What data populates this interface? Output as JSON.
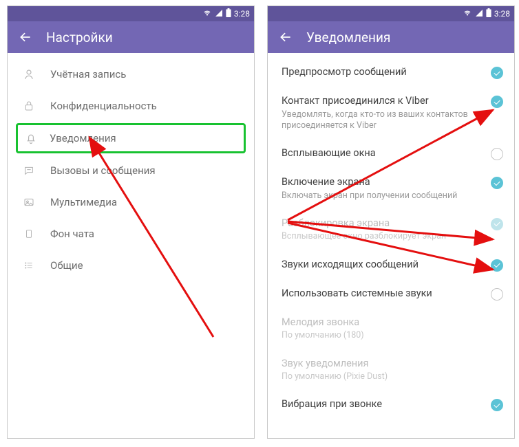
{
  "status": {
    "time": "3:28"
  },
  "left": {
    "title": "Настройки",
    "items": [
      {
        "label": "Учётная запись",
        "icon": "user"
      },
      {
        "label": "Конфиденциальность",
        "icon": "lock"
      },
      {
        "label": "Уведомления",
        "icon": "bell",
        "highlight": true
      },
      {
        "label": "Вызовы и сообщения",
        "icon": "chat"
      },
      {
        "label": "Мультимедиа",
        "icon": "media"
      },
      {
        "label": "Фон чата",
        "icon": "phone"
      },
      {
        "label": "Общие",
        "icon": "list"
      }
    ]
  },
  "right": {
    "title": "Уведомления",
    "items": [
      {
        "title": "Предпросмотр сообщений",
        "sub": "",
        "state": "on"
      },
      {
        "title": "Контакт присоединился к Viber",
        "sub": "Уведомлять, когда кто-то из ваших контактов присоединяется к Viber",
        "state": "on"
      },
      {
        "title": "Всплывающие окна",
        "sub": "",
        "state": "off"
      },
      {
        "title": "Включение экрана",
        "sub": "Включать экран при получении сообщений",
        "state": "on"
      },
      {
        "title": "Разблокировка экрана",
        "sub": "Всплывающее окно разблокирует экран",
        "state": "on_dim",
        "disabled": true
      },
      {
        "title": "Звуки исходящих сообщений",
        "sub": "",
        "state": "on"
      },
      {
        "title": "Использовать системные звуки",
        "sub": "",
        "state": "off"
      },
      {
        "title": "Мелодия звонка",
        "sub": "По умолчанию (180)",
        "state": "none",
        "disabled": true
      },
      {
        "title": "Звук уведомления",
        "sub": "По умолчанию (Pixie Dust)",
        "state": "none",
        "disabled": true
      },
      {
        "title": "Вибрация при звонке",
        "sub": "",
        "state": "on"
      }
    ]
  }
}
